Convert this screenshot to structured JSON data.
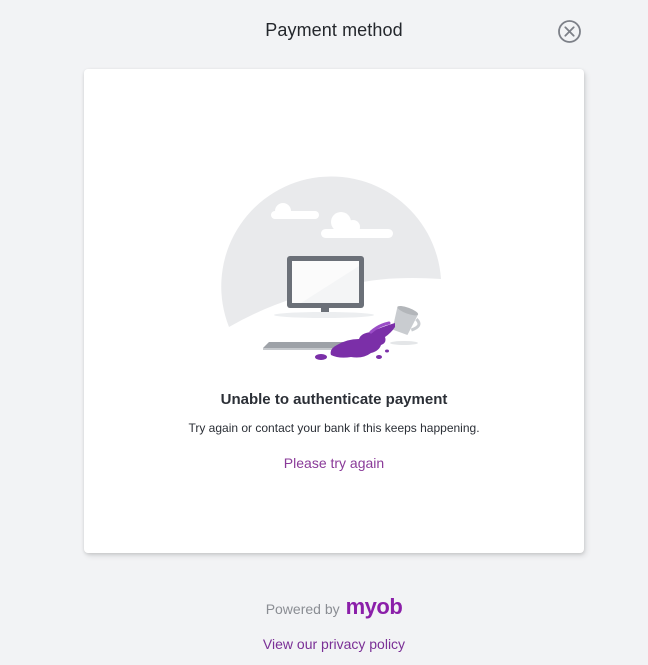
{
  "header": {
    "title": "Payment method",
    "close_icon": "close-circle-icon"
  },
  "card": {
    "illustration": "spilled-drink-computer-illustration",
    "error_title": "Unable to authenticate payment",
    "error_description": "Try again or contact your bank if this keeps happening.",
    "retry_link": "Please try again"
  },
  "footer": {
    "powered_by": "Powered by",
    "brand": "myob",
    "privacy_link": "View our privacy policy"
  },
  "colors": {
    "background": "#f2f3f5",
    "card": "#ffffff",
    "link": "#8a3b99",
    "brand": "#8b1fa9",
    "spill": "#7b2fa8"
  }
}
